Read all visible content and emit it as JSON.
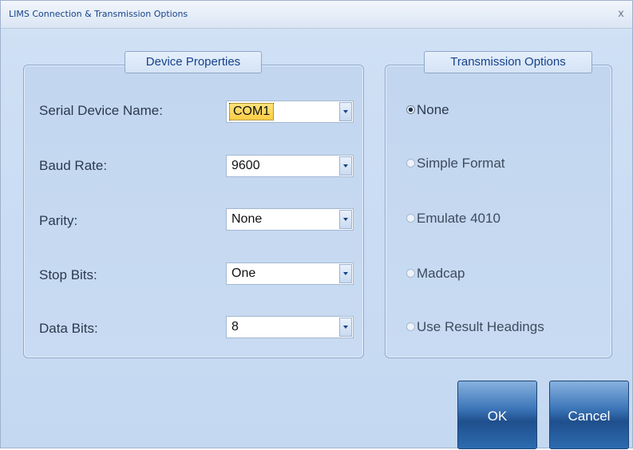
{
  "window": {
    "title": "LIMS Connection & Transmission Options",
    "close_glyph": "x"
  },
  "device_properties": {
    "legend": "Device Properties",
    "fields": [
      {
        "label": "Serial Device Name:",
        "value": "COM1"
      },
      {
        "label": "Baud Rate:",
        "value": "9600"
      },
      {
        "label": "Parity:",
        "value": "None"
      },
      {
        "label": "Stop Bits:",
        "value": "One"
      },
      {
        "label": "Data Bits:",
        "value": "8"
      }
    ]
  },
  "transmission_options": {
    "legend": "Transmission Options",
    "selected": "None",
    "options": [
      {
        "label": "None"
      },
      {
        "label": "Simple Format"
      },
      {
        "label": "Emulate 4010"
      },
      {
        "label": "Madcap"
      },
      {
        "label": "Use Result Headings"
      }
    ]
  },
  "buttons": {
    "ok_label": "OK",
    "cancel_label": "Cancel"
  },
  "colors": {
    "title_text": "#15428b",
    "panel_border": "#8fa8c8",
    "combo_highlight": "#fccd45",
    "button_blue": "#1f4f8d"
  }
}
